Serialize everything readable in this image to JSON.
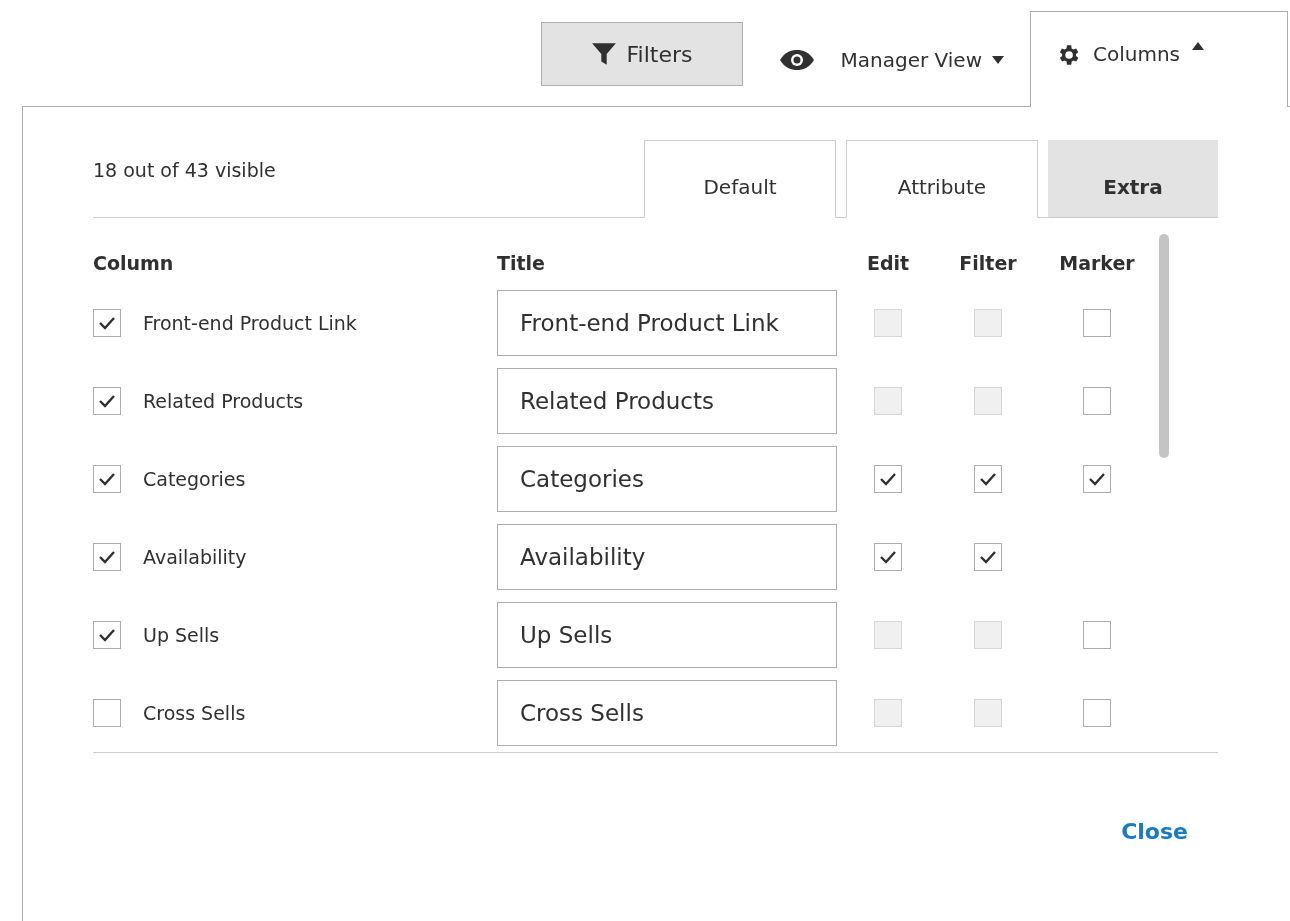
{
  "toolbar": {
    "filters": "Filters",
    "view": "Manager View",
    "columns": "Columns"
  },
  "panel": {
    "summary": "18 out of 43 visible",
    "tabs": [
      {
        "label": "Default",
        "selected": false
      },
      {
        "label": "Attribute",
        "selected": false
      },
      {
        "label": "Extra",
        "selected": true
      }
    ],
    "headers": {
      "column": "Column",
      "title": "Title",
      "edit": "Edit",
      "filter": "Filter",
      "marker": "Marker"
    },
    "rows": [
      {
        "label": "Front-end Product Link",
        "visible": true,
        "title": "Front-end Product Link",
        "edit": {
          "checked": false,
          "disabled": true
        },
        "filter": {
          "checked": false,
          "disabled": true
        },
        "marker": {
          "checked": false
        }
      },
      {
        "label": "Related Products",
        "visible": true,
        "title": "Related Products",
        "edit": {
          "checked": false,
          "disabled": true
        },
        "filter": {
          "checked": false,
          "disabled": true
        },
        "marker": {
          "checked": false
        }
      },
      {
        "label": "Categories",
        "visible": true,
        "title": "Categories",
        "edit": {
          "checked": true,
          "disabled": false
        },
        "filter": {
          "checked": true,
          "disabled": false
        },
        "marker": {
          "checked": true
        }
      },
      {
        "label": "Availability",
        "visible": true,
        "title": "Availability",
        "edit": {
          "checked": true,
          "disabled": false
        },
        "filter": {
          "checked": true,
          "disabled": false
        }
      },
      {
        "label": "Up Sells",
        "visible": true,
        "title": "Up Sells",
        "edit": {
          "checked": false,
          "disabled": true
        },
        "filter": {
          "checked": false,
          "disabled": true
        },
        "marker": {
          "checked": false
        }
      },
      {
        "label": "Cross Sells",
        "visible": false,
        "title": "Cross Sells",
        "edit": {
          "checked": false,
          "disabled": true
        },
        "filter": {
          "checked": false,
          "disabled": true
        },
        "marker": {
          "checked": false
        }
      }
    ],
    "close": "Close"
  }
}
